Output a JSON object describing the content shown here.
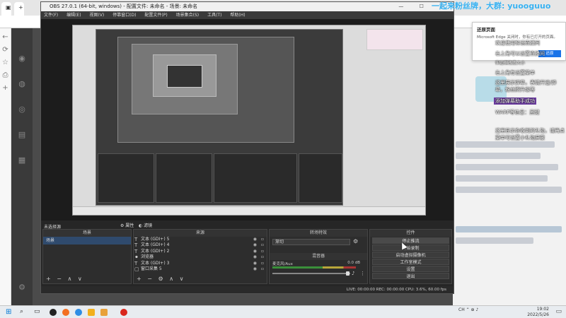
{
  "browser": {
    "tabs": [
      "",
      "",
      "",
      ""
    ],
    "left_icons": [
      "back-icon",
      "refresh-icon",
      "star-icon",
      "bookmark-icon"
    ]
  },
  "obs": {
    "window_title": "OBS 27.0.1 (64-bit, windows) - 配置文件: 未命名 - 场景: 未命名",
    "window_controls": "— ☐ ✕",
    "menu": [
      "文件(F)",
      "编辑(E)",
      "视图(V)",
      "停靠窗口(D)",
      "配置文件(P)",
      "场景集合(S)",
      "工具(T)",
      "帮助(H)"
    ],
    "scene_bar": "未选择源",
    "scene_props": "属性",
    "scene_filters": "滤镜",
    "scenes_dock": {
      "title": "场景",
      "items": [
        "场景"
      ]
    },
    "sources_dock": {
      "title": "来源",
      "items": [
        {
          "icon": "T",
          "label": "文本 (GDI+) 5"
        },
        {
          "icon": "T",
          "label": "文本 (GDI+) 4"
        },
        {
          "icon": "T",
          "label": "文本 (GDI+) 2"
        },
        {
          "icon": "⚫",
          "label": "浏览器"
        },
        {
          "icon": "T",
          "label": "文本 (GDI+) 3"
        },
        {
          "icon": "▢",
          "label": "窗口采集 5"
        }
      ]
    },
    "transitions_dock": {
      "title": "转场特效",
      "select": "渐切"
    },
    "mixer_dock": {
      "title": "混音器",
      "channel": "麦克风/Aux",
      "level": "0.0 dB"
    },
    "controls_dock": {
      "title": "控件",
      "buttons": [
        "停止推流",
        "开始录制",
        "启动虚拟摄像机",
        "工作室模式",
        "设置",
        "退出"
      ]
    },
    "status": "LIVE: 00:00:00   REC: 00:00:00   CPU: 3.6%, 60.00 fps"
  },
  "watermark": "一起来粉丝牌，大群: yuooguuo",
  "popup": {
    "title": "还原页面",
    "message": "Microsoft Edge 关闭时，你有已打开的页面。",
    "button": "还原"
  },
  "annotations": [
    "欢迎使用轻语直播间",
    "右上角可以设置直播间",
    "小主播请您添加关注，来帮助",
    "您的直播",
    "伸边框改变大小",
    "右上角有设置菜单",
    "这里展示弹幕，表情开通/弹幕，粉丝牌升级等",
    "添加弹幕助手成功",
    "WARP等信息：黑键",
    "这里显示你收到的礼物，请再点菜单可设置小礼物屏蔽"
  ],
  "taskbar": {
    "clock_time": "19:02",
    "clock_date": "2022/5/26",
    "tray": "CH ⌃ ⊕ ♪"
  }
}
